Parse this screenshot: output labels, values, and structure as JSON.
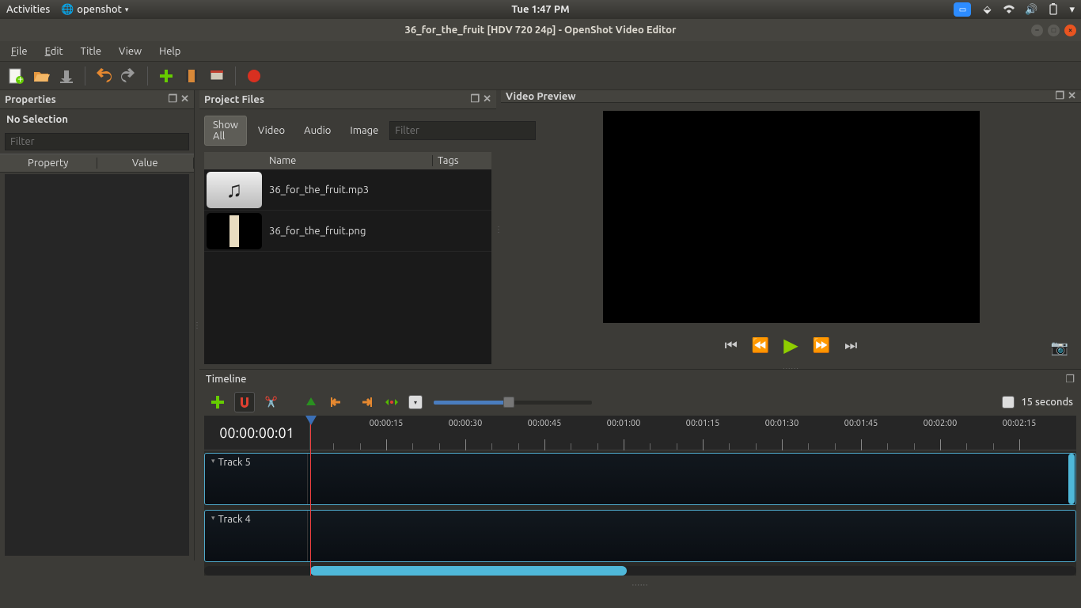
{
  "sysbar": {
    "activities": "Activities",
    "app_name": "openshot",
    "clock": "Tue  1:47 PM"
  },
  "titlebar": {
    "title": "36_for_the_fruit [HDV 720 24p] - OpenShot Video Editor"
  },
  "menubar": [
    "File",
    "Edit",
    "Title",
    "View",
    "Help"
  ],
  "panels": {
    "properties": "Properties",
    "project_files": "Project Files",
    "video_preview": "Video Preview",
    "timeline": "Timeline"
  },
  "properties": {
    "no_selection": "No Selection",
    "filter_placeholder": "Filter",
    "cols": {
      "property": "Property",
      "value": "Value"
    }
  },
  "project_files": {
    "tabs": {
      "show_all": "Show All",
      "video": "Video",
      "audio": "Audio",
      "image": "Image"
    },
    "filter_placeholder": "Filter",
    "cols": {
      "name": "Name",
      "tags": "Tags"
    },
    "rows": [
      {
        "name": "36_for_the_fruit.mp3",
        "kind": "music"
      },
      {
        "name": "36_for_the_fruit.png",
        "kind": "img"
      }
    ]
  },
  "timeline": {
    "timecode": "00:00:00:01",
    "zoom_label": "15 seconds",
    "ruler": [
      "00:00:15",
      "00:00:30",
      "00:00:45",
      "00:01:00",
      "00:01:15",
      "00:01:30",
      "00:01:45",
      "00:02:00",
      "00:02:15"
    ],
    "tracks": [
      {
        "name": "Track 5"
      },
      {
        "name": "Track 4"
      }
    ]
  },
  "colors": {
    "accent_orange": "#e95420",
    "play_green": "#8fce00",
    "track_border": "#4fa8c9"
  }
}
